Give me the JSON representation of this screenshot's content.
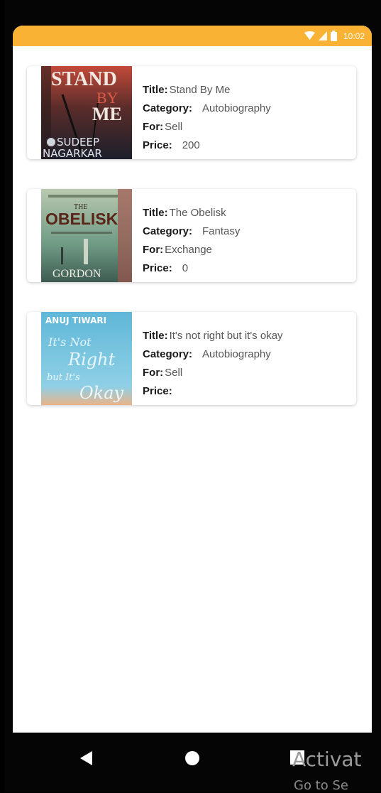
{
  "status_bar": {
    "time": "10:02",
    "icons": [
      "wifi-icon",
      "cellular-icon",
      "battery-icon"
    ],
    "background": "#f9b233"
  },
  "labels": {
    "title": "Title:",
    "category": "Category:",
    "for": "For:",
    "price": "Price:"
  },
  "books": [
    {
      "title": "Stand By Me",
      "category": "Autobiography",
      "for": "Sell",
      "price": "200",
      "cover_text": [
        "STAND",
        "BY",
        "ME",
        "SUDEEP",
        "NAGARKAR"
      ]
    },
    {
      "title": "The Obelisk",
      "category": "Fantasy",
      "for": "Exchange",
      "price": "0",
      "cover_text": [
        "THE",
        "OBELISK",
        "GORDON"
      ]
    },
    {
      "title": "It's not right but it's okay",
      "category": "Autobiography",
      "for": "Sell",
      "price": "",
      "cover_text": [
        "ANUJ TIWARI",
        "It's Not",
        "Right",
        "but It's",
        "Okay"
      ]
    }
  ],
  "nav_bar": {
    "buttons": [
      "back-icon",
      "home-icon",
      "recents-icon"
    ]
  },
  "watermark": {
    "line1": "Activat",
    "line2": "Go to Se"
  }
}
